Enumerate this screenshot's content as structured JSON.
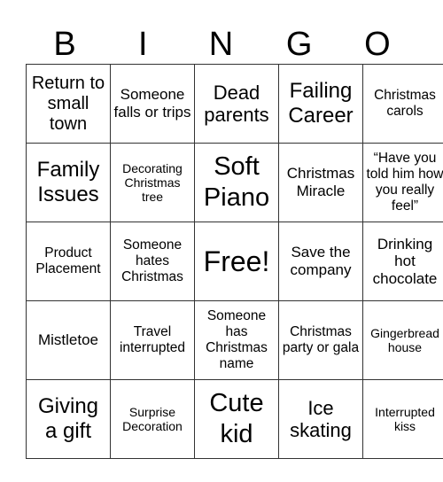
{
  "header": [
    "B",
    "I",
    "N",
    "G",
    "O"
  ],
  "rows": [
    [
      "Return to small town",
      "Someone falls or trips",
      "Dead parents",
      "Failing Career",
      "Christmas carols"
    ],
    [
      "Family Issues",
      "Decorating Christmas tree",
      "Soft Piano",
      "Christmas Miracle",
      "“Have you told him how you really feel”"
    ],
    [
      "Product Placement",
      "Someone hates Christmas",
      "Free!",
      "Save the company",
      "Drinking hot chocolate"
    ],
    [
      "Mistletoe",
      "Travel interrupted",
      "Someone has Christmas name",
      "Christmas party or gala",
      "Gingerbread house"
    ],
    [
      "Giving a gift",
      "Surprise Decoration",
      "Cute kid",
      "Ice skating",
      "Interrupted kiss"
    ]
  ]
}
